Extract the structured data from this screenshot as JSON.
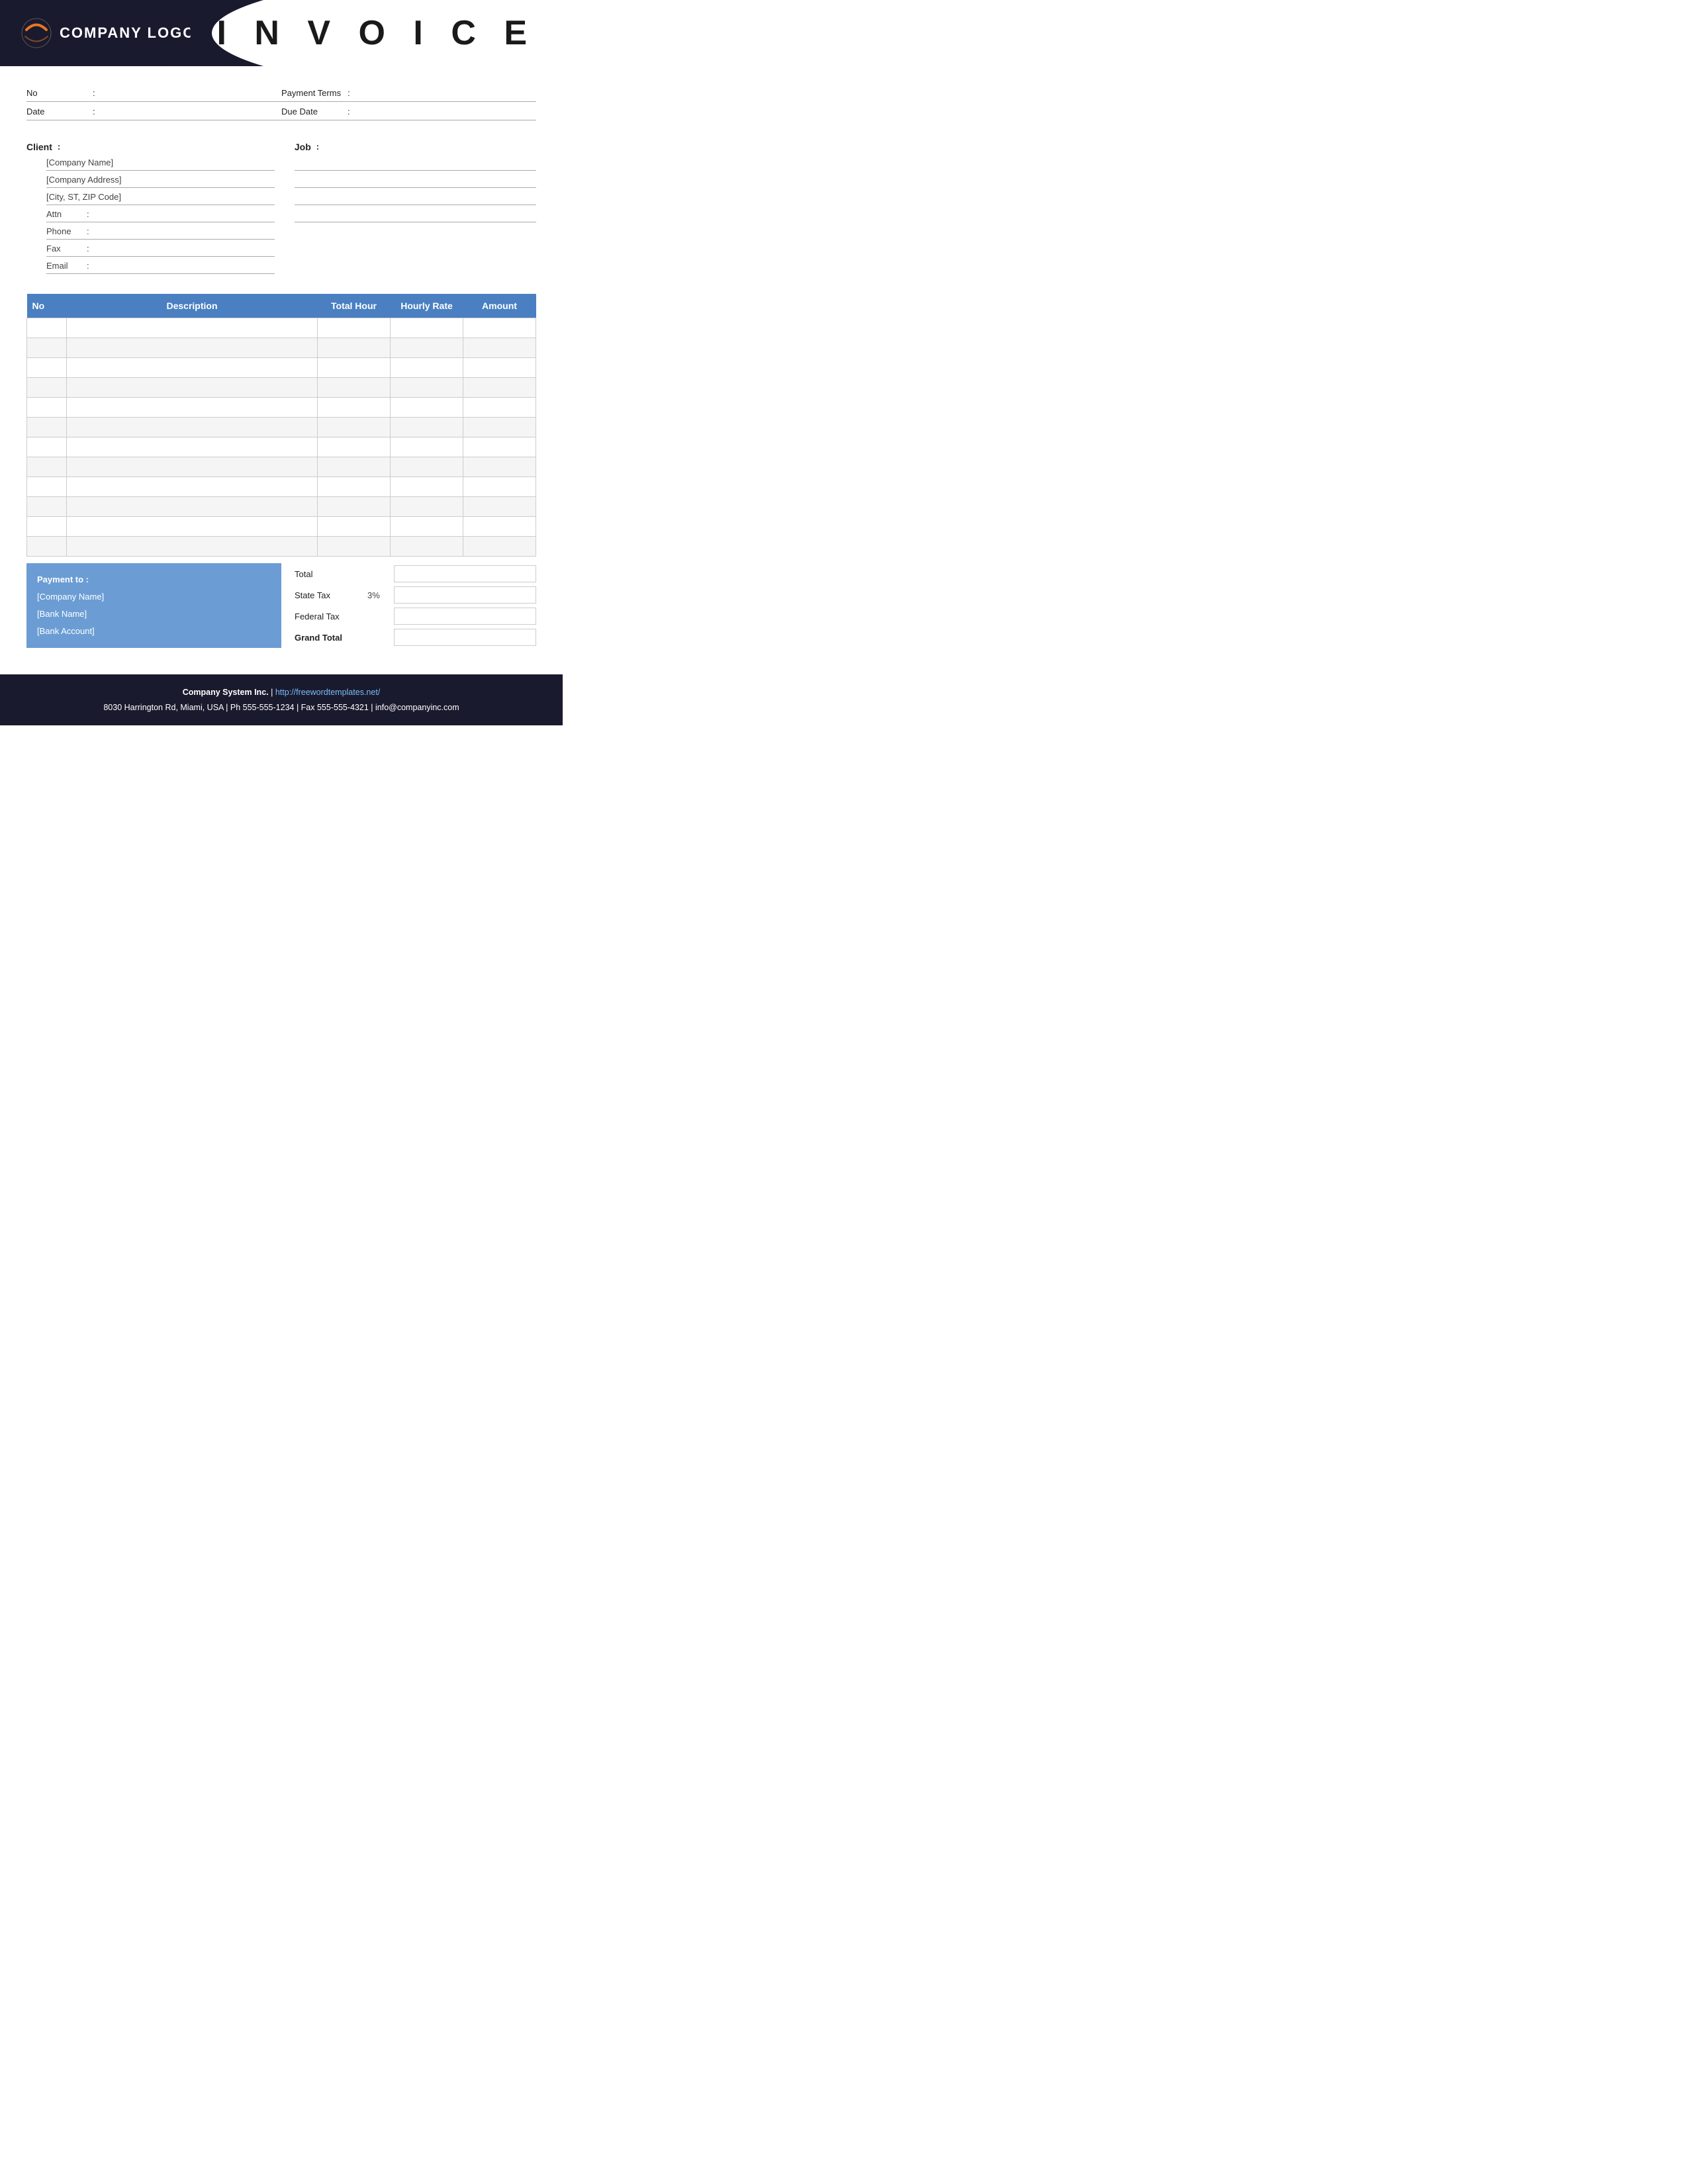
{
  "header": {
    "logo_text": "COMPANY LOGO",
    "invoice_title": "I N V O I C E"
  },
  "meta": {
    "no_label": "No",
    "no_colon": ":",
    "no_value": "",
    "payment_terms_label": "Payment  Terms",
    "payment_terms_colon": ":",
    "payment_terms_value": "",
    "date_label": "Date",
    "date_colon": ":",
    "date_value": "",
    "due_date_label": "Due Date",
    "due_date_colon": ":",
    "due_date_value": ""
  },
  "client": {
    "label": "Client",
    "colon": ":",
    "company_name": "[Company Name]",
    "company_address": "[Company Address]",
    "city_state_zip": "[City, ST, ZIP Code]",
    "attn_label": "Attn",
    "attn_colon": ":",
    "attn_value": "",
    "phone_label": "Phone",
    "phone_colon": ":",
    "phone_value": "",
    "fax_label": "Fax",
    "fax_colon": ":",
    "fax_value": "",
    "email_label": "Email",
    "email_colon": ":",
    "email_value": ""
  },
  "job": {
    "label": "Job",
    "colon": ":",
    "line1": "",
    "line2": "",
    "line3": "",
    "line4": ""
  },
  "table": {
    "headers": {
      "no": "No",
      "description": "Description",
      "total_hour": "Total Hour",
      "hourly_rate": "Hourly Rate",
      "amount": "Amount"
    },
    "rows": [
      {
        "no": "",
        "description": "",
        "total_hour": "",
        "hourly_rate": "",
        "amount": ""
      },
      {
        "no": "",
        "description": "",
        "total_hour": "",
        "hourly_rate": "",
        "amount": ""
      },
      {
        "no": "",
        "description": "",
        "total_hour": "",
        "hourly_rate": "",
        "amount": ""
      },
      {
        "no": "",
        "description": "",
        "total_hour": "",
        "hourly_rate": "",
        "amount": ""
      },
      {
        "no": "",
        "description": "",
        "total_hour": "",
        "hourly_rate": "",
        "amount": ""
      },
      {
        "no": "",
        "description": "",
        "total_hour": "",
        "hourly_rate": "",
        "amount": ""
      },
      {
        "no": "",
        "description": "",
        "total_hour": "",
        "hourly_rate": "",
        "amount": ""
      },
      {
        "no": "",
        "description": "",
        "total_hour": "",
        "hourly_rate": "",
        "amount": ""
      },
      {
        "no": "",
        "description": "",
        "total_hour": "",
        "hourly_rate": "",
        "amount": ""
      },
      {
        "no": "",
        "description": "",
        "total_hour": "",
        "hourly_rate": "",
        "amount": ""
      },
      {
        "no": "",
        "description": "",
        "total_hour": "",
        "hourly_rate": "",
        "amount": ""
      },
      {
        "no": "",
        "description": "",
        "total_hour": "",
        "hourly_rate": "",
        "amount": ""
      }
    ]
  },
  "payment": {
    "title": "Payment to :",
    "company_name": "[Company Name]",
    "bank_name": "[Bank Name]",
    "bank_account": "[Bank Account]"
  },
  "totals": {
    "total_label": "Total",
    "state_tax_label": "State Tax",
    "state_tax_pct": "3%",
    "federal_tax_label": "Federal Tax",
    "grand_total_label": "Grand Total",
    "total_value": "",
    "state_tax_value": "",
    "federal_tax_value": "",
    "grand_total_value": ""
  },
  "footer": {
    "company_name": "Company System Inc.",
    "separator": "|",
    "website": "http://freewordtemplates.net/",
    "address": "8030 Harrington Rd, Miami, USA | Ph 555-555-1234 | Fax 555-555-4321 | info@companyinc.com"
  }
}
